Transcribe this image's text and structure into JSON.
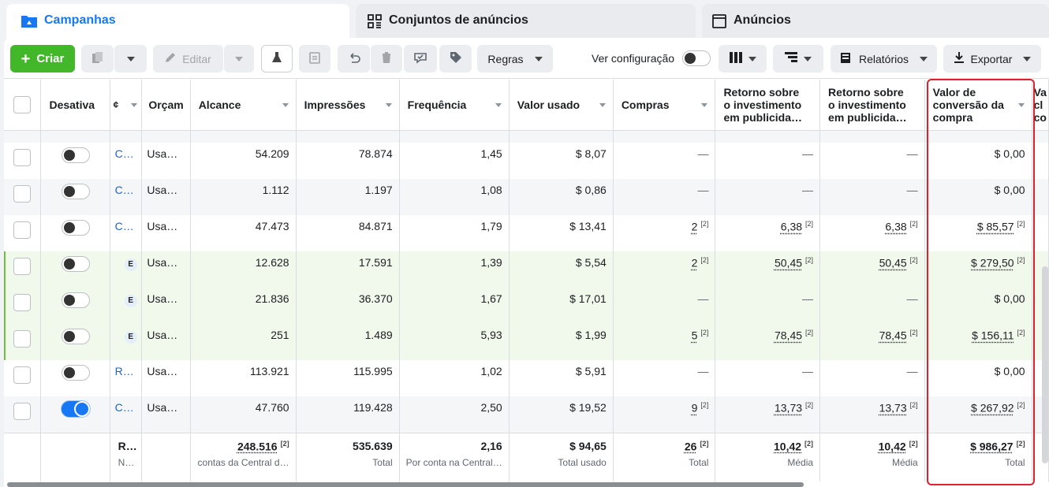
{
  "tabs": [
    {
      "label": "Campanhas",
      "icon": "folder-icon",
      "active": true
    },
    {
      "label": "Conjuntos de anúncios",
      "icon": "grid-icon"
    },
    {
      "label": "Anúncios",
      "icon": "ad-window-icon"
    }
  ],
  "toolbar": {
    "create_label": "Criar",
    "edit_label": "Editar",
    "rules_label": "Regras",
    "view_config_label": "Ver configuração",
    "reports_label": "Relatórios",
    "export_label": "Exportar"
  },
  "columns": [
    "Desativa",
    "",
    "Orçam",
    "Alcance",
    "Impressões",
    "Frequência",
    "Valor usado",
    "Compras",
    "Retorno sobre o investimento em publicida…",
    "Retorno sobre o investimento em publicida…",
    "Valor de conversão da compra",
    "Va"
  ],
  "columns_extra": {
    "last_line2": "cl",
    "last_line3": "co"
  },
  "rows": [
    {
      "on": false,
      "name": "C…",
      "budget": "Usa…",
      "reach": "54.209",
      "impr": "78.874",
      "freq": "1,45",
      "spent": "$ 8,07",
      "purch": "—",
      "roas1": "—",
      "roas2": "—",
      "conv": "$ 0,00"
    },
    {
      "on": false,
      "name": "C…",
      "budget": "Usa…",
      "reach": "1.112",
      "impr": "1.197",
      "freq": "1,08",
      "spent": "$ 0,86",
      "purch": "—",
      "roas1": "—",
      "roas2": "—",
      "conv": "$ 0,00"
    },
    {
      "on": false,
      "name": "C…",
      "budget": "Usa…",
      "reach": "47.473",
      "impr": "84.871",
      "freq": "1,79",
      "spent": "$ 13,41",
      "purch": "2",
      "roas1": "6,38",
      "roas2": "6,38",
      "conv": "$ 85,57"
    },
    {
      "on": false,
      "name": "E",
      "budget": "Usa…",
      "reach": "12.628",
      "impr": "17.591",
      "freq": "1,39",
      "spent": "$ 5,54",
      "purch": "2",
      "roas1": "50,45",
      "roas2": "50,45",
      "conv": "$ 279,50"
    },
    {
      "on": false,
      "name": "E",
      "budget": "Usa…",
      "reach": "21.836",
      "impr": "36.370",
      "freq": "1,67",
      "spent": "$ 17,01",
      "purch": "—",
      "roas1": "—",
      "roas2": "—",
      "conv": "$ 0,00"
    },
    {
      "on": false,
      "name": "E",
      "budget": "Usa…",
      "reach": "251",
      "impr": "1.489",
      "freq": "5,93",
      "spent": "$ 1,99",
      "purch": "5",
      "roas1": "78,45",
      "roas2": "78,45",
      "conv": "$ 156,11"
    },
    {
      "on": false,
      "name": "R…",
      "budget": "Usa…",
      "reach": "113.921",
      "impr": "115.995",
      "freq": "1,02",
      "spent": "$ 5,91",
      "purch": "—",
      "roas1": "—",
      "roas2": "—",
      "conv": "$ 0,00"
    },
    {
      "on": true,
      "name": "C…",
      "budget": "Usa…",
      "reach": "47.760",
      "impr": "119.428",
      "freq": "2,50",
      "spent": "$ 19,52",
      "purch": "9",
      "roas1": "13,73",
      "roas2": "13,73",
      "conv": "$ 267,92"
    }
  ],
  "note_mark": "[2]",
  "totals": {
    "name": "R…",
    "name_sub": "N…",
    "reach": "248.516",
    "reach_sub": "contas da Central d…",
    "impr": "535.639",
    "impr_sub": "Total",
    "freq": "2,16",
    "freq_sub": "Por conta na Central…",
    "spent": "$ 94,65",
    "spent_sub": "Total usado",
    "purch": "26",
    "purch_sub": "Total",
    "roas1": "10,42",
    "roas1_sub": "Média",
    "roas2": "10,42",
    "roas2_sub": "Média",
    "conv": "$ 986,27",
    "conv_sub": "Total"
  },
  "colors": {
    "accent": "#1877f2",
    "create": "#42b72a",
    "highlight": "#e0202a"
  }
}
